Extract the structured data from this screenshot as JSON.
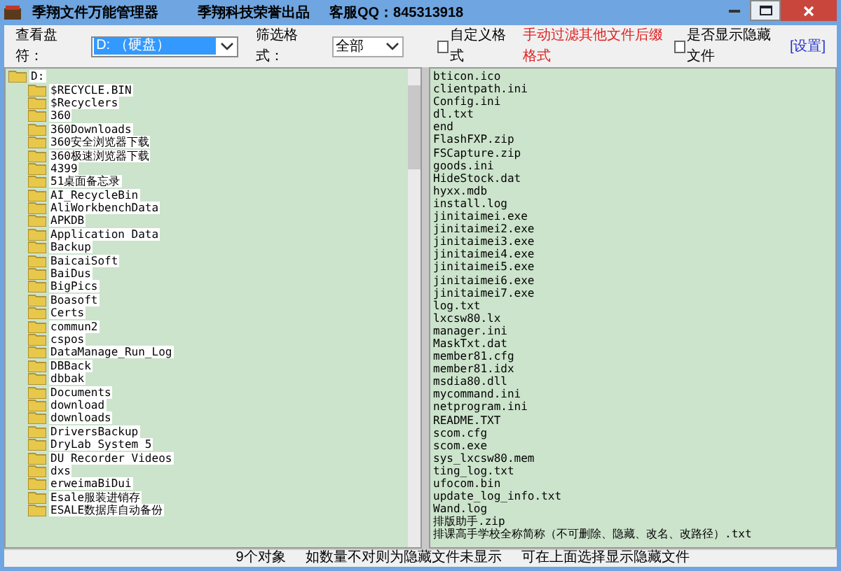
{
  "window": {
    "title": "季翔文件万能管理器",
    "publisher": "季翔科技荣誉出品",
    "contact": "客服QQ：845313918"
  },
  "toolbar": {
    "drive_label": "查看盘符：",
    "drive_value": "D: （硬盘）",
    "filter_label": "筛选格式：",
    "filter_value": "全部",
    "custom_format": {
      "label": "自定义格式",
      "checked": false
    },
    "hint": "手动过滤其他文件后缀格式",
    "show_hidden": {
      "label": "是否显示隐藏文件",
      "checked": false
    },
    "settings_link": "[设置]"
  },
  "folder_tree": {
    "label": "D:",
    "children": [
      {
        "label": "$RECYCLE.BIN"
      },
      {
        "label": "$Recyclers"
      },
      {
        "label": "360"
      },
      {
        "label": "360Downloads"
      },
      {
        "label": "360安全浏览器下载"
      },
      {
        "label": "360极速浏览器下载"
      },
      {
        "label": "4399"
      },
      {
        "label": "51桌面备忘录"
      },
      {
        "label": "AI_RecycleBin"
      },
      {
        "label": "AliWorkbenchData"
      },
      {
        "label": "APKDB"
      },
      {
        "label": "Application Data"
      },
      {
        "label": "Backup"
      },
      {
        "label": "BaicaiSoft"
      },
      {
        "label": "BaiDus"
      },
      {
        "label": "BigPics"
      },
      {
        "label": "Boasoft"
      },
      {
        "label": "Certs"
      },
      {
        "label": "commun2"
      },
      {
        "label": "cspos"
      },
      {
        "label": "DataManage_Run_Log"
      },
      {
        "label": "DBBack"
      },
      {
        "label": "dbbak"
      },
      {
        "label": "Documents"
      },
      {
        "label": "download"
      },
      {
        "label": "downloads"
      },
      {
        "label": "DriversBackup"
      },
      {
        "label": "DryLab System 5"
      },
      {
        "label": "DU Recorder Videos"
      },
      {
        "label": "dxs"
      },
      {
        "label": "erweimaBiDui"
      },
      {
        "label": "Esale服装进销存"
      },
      {
        "label": "ESALE数据库自动备份"
      }
    ]
  },
  "file_list": [
    "bticon.ico",
    "clientpath.ini",
    "Config.ini",
    "dl.txt",
    "end",
    "FlashFXP.zip",
    "FSCapture.zip",
    "goods.ini",
    "HideStock.dat",
    "hyxx.mdb",
    "install.log",
    "jinitaimei.exe",
    "jinitaimei2.exe",
    "jinitaimei3.exe",
    "jinitaimei4.exe",
    "jinitaimei5.exe",
    "jinitaimei6.exe",
    "jinitaimei7.exe",
    "log.txt",
    "lxcsw80.lx",
    "manager.ini",
    "MaskTxt.dat",
    "member81.cfg",
    "member81.idx",
    "msdia80.dll",
    "mycommand.ini",
    "netprogram.ini",
    "README.TXT",
    "scom.cfg",
    "scom.exe",
    "sys_lxcsw80.mem",
    "ting_log.txt",
    "ufocom.bin",
    "update_log_info.txt",
    "Wand.log",
    "排版助手.zip",
    "排课高手学校全称简称（不可删除、隐藏、改名、改路径）.txt"
  ],
  "status_bar": [
    "9个对象",
    "如数量不对则为隐藏文件未显示",
    "可在上面选择显示隐藏文件"
  ]
}
